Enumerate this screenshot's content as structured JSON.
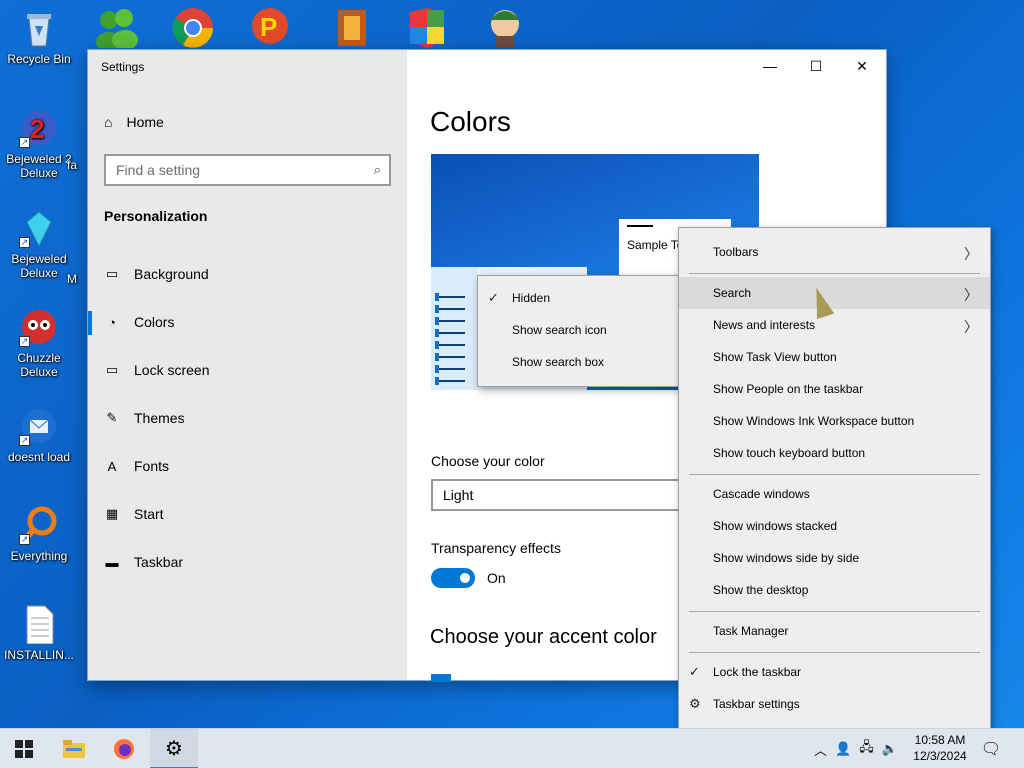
{
  "desktop": {
    "icons": [
      {
        "label": "Recycle Bin",
        "icon": "recycle-bin-icon"
      },
      {
        "label": "Bejeweled 2 Deluxe",
        "icon": "bejeweled-2-icon"
      },
      {
        "label": "Bejeweled Deluxe",
        "icon": "bejeweled-icon"
      },
      {
        "label": "Chuzzle Deluxe",
        "icon": "chuzzle-icon"
      },
      {
        "label": "doesnt load",
        "icon": "thunderbird-icon"
      },
      {
        "label": "Everything",
        "icon": "everything-search-icon"
      },
      {
        "label": "INSTALLIN...",
        "icon": "text-document-icon"
      }
    ],
    "partial_labels": [
      "fa",
      "M"
    ]
  },
  "settings": {
    "window_title": "Settings",
    "home_label": "Home",
    "search_placeholder": "Find a setting",
    "section": "Personalization",
    "nav": [
      {
        "label": "Background",
        "icon": "picture-icon"
      },
      {
        "label": "Colors",
        "icon": "palette-icon"
      },
      {
        "label": "Lock screen",
        "icon": "lock-screen-icon"
      },
      {
        "label": "Themes",
        "icon": "themes-icon"
      },
      {
        "label": "Fonts",
        "icon": "fonts-icon"
      },
      {
        "label": "Start",
        "icon": "start-icon"
      },
      {
        "label": "Taskbar",
        "icon": "taskbar-icon"
      }
    ],
    "selected_nav": "Colors",
    "page_title": "Colors",
    "preview_sample": "Sample Te",
    "choose_color_label": "Choose your color",
    "choose_color_value": "Light",
    "transparency_label": "Transparency effects",
    "transparency_state": "On",
    "accent_title": "Choose your accent color"
  },
  "search_submenu": {
    "items": [
      {
        "label": "Hidden",
        "checked": true
      },
      {
        "label": "Show search icon",
        "checked": false
      },
      {
        "label": "Show search box",
        "checked": false
      }
    ]
  },
  "taskbar_menu": {
    "items": [
      {
        "label": "Toolbars",
        "submenu": true
      },
      {
        "label": "Search",
        "submenu": true,
        "highlighted": true
      },
      {
        "label": "News and interests",
        "submenu": true
      },
      {
        "label": "Show Task View button"
      },
      {
        "label": "Show People on the taskbar"
      },
      {
        "label": "Show Windows Ink Workspace button"
      },
      {
        "label": "Show touch keyboard button"
      },
      {
        "label": "Cascade windows"
      },
      {
        "label": "Show windows stacked"
      },
      {
        "label": "Show windows side by side"
      },
      {
        "label": "Show the desktop"
      },
      {
        "label": "Task Manager"
      },
      {
        "label": "Lock the taskbar",
        "checked": true
      },
      {
        "label": "Taskbar settings",
        "icon": "gear-icon"
      }
    ]
  },
  "taskbar": {
    "time": "10:58 AM",
    "date": "12/3/2024",
    "apps": [
      "start-icon",
      "file-explorer-icon",
      "firefox-icon",
      "settings-gear-icon"
    ]
  },
  "colors": {
    "accent": "#0078d7",
    "desktop": "#0f6fd6"
  }
}
